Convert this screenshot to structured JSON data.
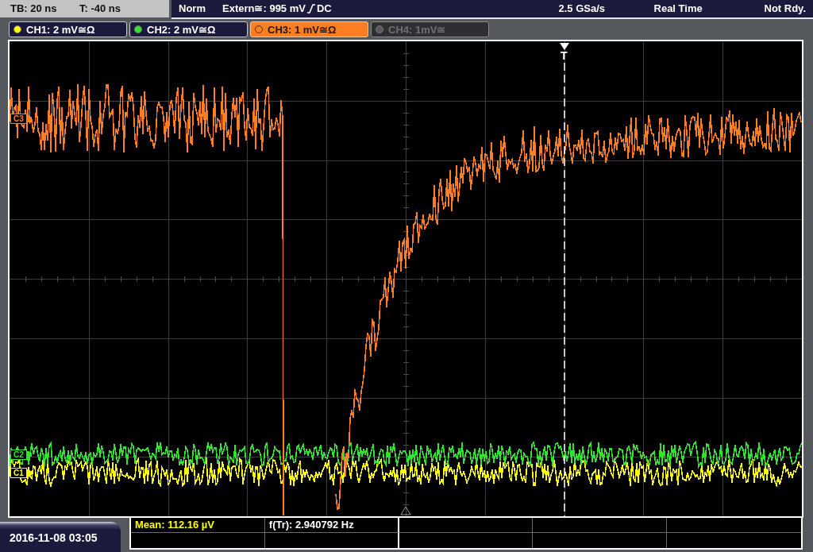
{
  "top_bar": {
    "timebase": "TB: 20 ns",
    "trigger_offset": "T: -40 ns",
    "trigger_mode": "Norm",
    "trigger_source": "Extern≅: 995 mV",
    "trigger_coupling": "DC",
    "sample_rate": "2.5 GSa/s",
    "acquisition_mode": "Real Time",
    "status": "Not Rdy."
  },
  "channels": [
    {
      "label": "CH1: 2 mV≅Ω",
      "color": "#ffff00",
      "selected": false,
      "on": true
    },
    {
      "label": "CH2: 2 mV≅Ω",
      "color": "#2ee62e",
      "selected": false,
      "on": true
    },
    {
      "label": "CH3: 1 mV≅Ω",
      "color": "#ff7e20",
      "selected": true,
      "on": true
    },
    {
      "label": "CH4: 1mV≅",
      "color": "#5a5a5a",
      "selected": false,
      "on": false
    }
  ],
  "plot": {
    "trigger_label": "T",
    "channel_markers": [
      {
        "label": "C3",
        "color": "#ff7e20"
      },
      {
        "label": "C2",
        "color": "#2ee62e"
      },
      {
        "label": "C1",
        "color": "#ffff00"
      }
    ]
  },
  "measurements": [
    {
      "text": "Mean: 112.16 µV",
      "color": "#ffff00"
    },
    {
      "text": "f(Tr): 2.940792 Hz",
      "color": "#ffffff"
    }
  ],
  "date_time": "2016-11-08 03:05"
}
